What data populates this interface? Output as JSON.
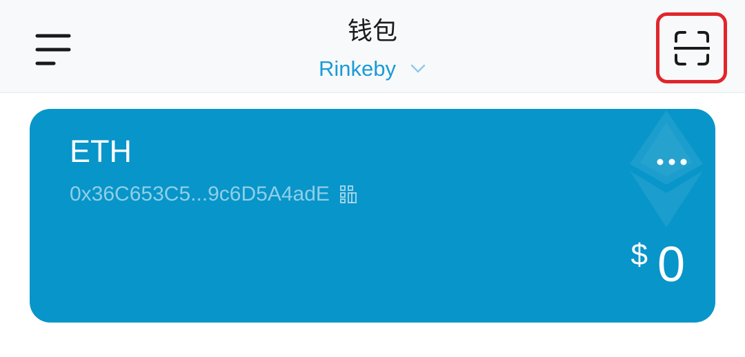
{
  "header": {
    "title": "钱包",
    "network": "Rinkeby"
  },
  "card": {
    "coin": "ETH",
    "address": "0x36C653C5...9c6D5A4adE",
    "currency_symbol": "$",
    "balance": "0",
    "color": "#0895c9"
  },
  "icons": {
    "menu": "hamburger-menu-icon",
    "network_dropdown": "chevron-down-icon",
    "scan": "scan-icon",
    "qr": "qr-code-icon",
    "more": "more-dots-icon",
    "watermark": "ethereum-logo"
  },
  "colors": {
    "accent": "#1a9bd7",
    "highlight": "#e0262b"
  }
}
